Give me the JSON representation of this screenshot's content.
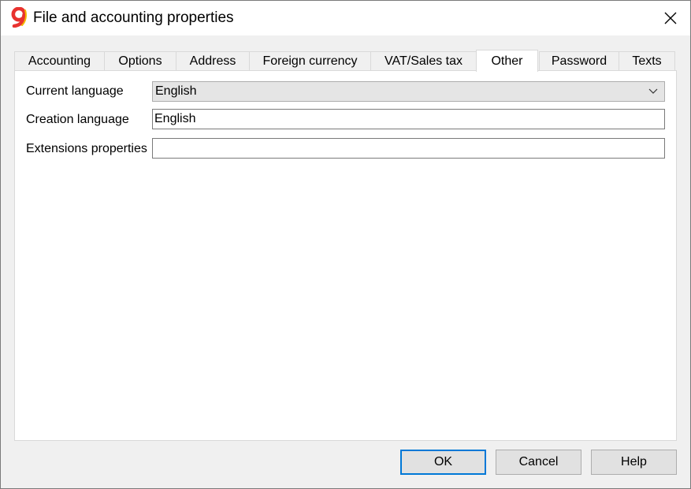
{
  "window": {
    "title": "File and accounting properties"
  },
  "icons": {
    "app": "banana-9-logo-icon",
    "close": "close-icon",
    "dropdown": "chevron-down-icon"
  },
  "tabs": [
    {
      "label": "Accounting"
    },
    {
      "label": "Options"
    },
    {
      "label": "Address"
    },
    {
      "label": "Foreign currency"
    },
    {
      "label": "VAT/Sales tax"
    },
    {
      "label": "Other",
      "active": true
    },
    {
      "label": "Password"
    },
    {
      "label": "Texts"
    }
  ],
  "form": {
    "current_language": {
      "label": "Current language",
      "value": "English"
    },
    "creation_language": {
      "label": "Creation language",
      "value": "English"
    },
    "extensions_properties": {
      "label": "Extensions properties",
      "value": ""
    }
  },
  "buttons": {
    "ok": "OK",
    "cancel": "Cancel",
    "help": "Help"
  },
  "colors": {
    "logo_red": "#e8322f",
    "logo_yellow": "#f5b700",
    "focus_blue": "#0078d7"
  }
}
